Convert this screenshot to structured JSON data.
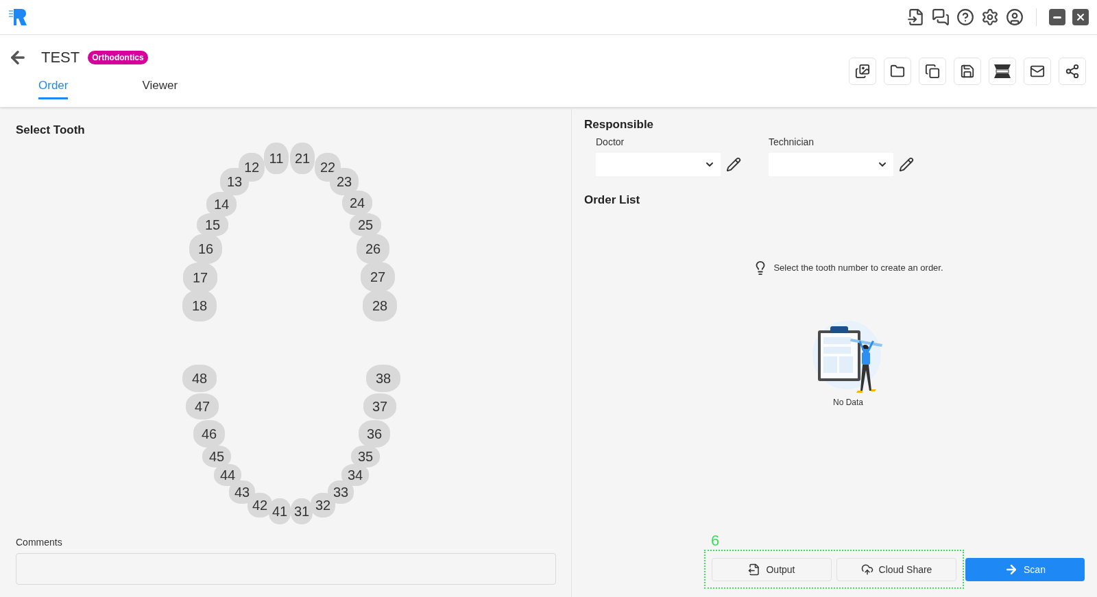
{
  "header": {
    "title": "TEST",
    "badge": "Orthodontics",
    "tabs": [
      {
        "label": "Order",
        "selected": true
      },
      {
        "label": "Viewer",
        "selected": false
      }
    ]
  },
  "select_tooth": {
    "heading": "Select Tooth",
    "upper_teeth": [
      {
        "label": "11",
        "selected": false
      },
      {
        "label": "21",
        "selected": false
      },
      {
        "label": "12",
        "selected": false
      },
      {
        "label": "22",
        "selected": false
      },
      {
        "label": "13",
        "selected": false
      },
      {
        "label": "23",
        "selected": false
      },
      {
        "label": "14",
        "selected": false
      },
      {
        "label": "24",
        "selected": false
      },
      {
        "label": "15",
        "selected": false
      },
      {
        "label": "25",
        "selected": false
      },
      {
        "label": "16",
        "selected": false
      },
      {
        "label": "26",
        "selected": false
      },
      {
        "label": "17",
        "selected": false
      },
      {
        "label": "27",
        "selected": false
      },
      {
        "label": "18",
        "selected": false
      },
      {
        "label": "28",
        "selected": false
      }
    ],
    "lower_teeth": [
      {
        "label": "48",
        "selected": false
      },
      {
        "label": "38",
        "selected": false
      },
      {
        "label": "47",
        "selected": false
      },
      {
        "label": "37",
        "selected": false
      },
      {
        "label": "46",
        "selected": false
      },
      {
        "label": "36",
        "selected": false
      },
      {
        "label": "45",
        "selected": false
      },
      {
        "label": "35",
        "selected": false
      },
      {
        "label": "44",
        "selected": false
      },
      {
        "label": "34",
        "selected": false
      },
      {
        "label": "43",
        "selected": false
      },
      {
        "label": "33",
        "selected": false
      },
      {
        "label": "42",
        "selected": false
      },
      {
        "label": "32",
        "selected": false
      },
      {
        "label": "41",
        "selected": false
      },
      {
        "label": "31",
        "selected": false
      }
    ],
    "comments_label": "Comments"
  },
  "responsible": {
    "heading": "Responsible",
    "doctor_label": "Doctor",
    "technician_label": "Technician"
  },
  "order_list": {
    "heading": "Order List",
    "hint": "Select the tooth number to create an order.",
    "empty": "No Data"
  },
  "buttons": [
    {
      "label": "Output",
      "kind": "secondary"
    },
    {
      "label": "Cloud Share",
      "kind": "secondary"
    },
    {
      "label": "Scan",
      "kind": "primary"
    }
  ],
  "callout": {
    "number": "6"
  }
}
